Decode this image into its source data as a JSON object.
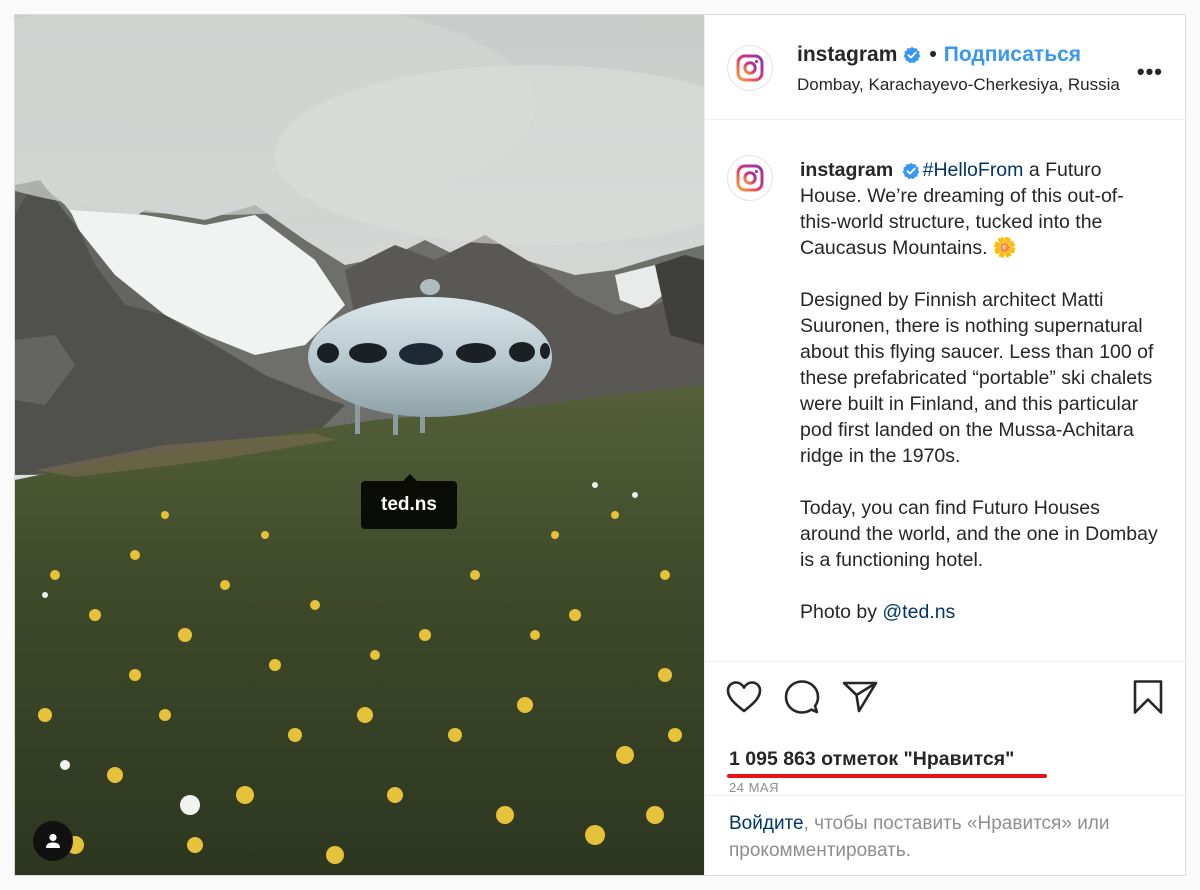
{
  "photo": {
    "tag_label": "ted.ns",
    "user_tag_icon": "user-icon"
  },
  "header": {
    "username": "instagram",
    "separator": "•",
    "follow_label": "Подписаться",
    "location": "Dombay, Karachayevo-Cherkesiya, Russia",
    "more_label": "•••"
  },
  "caption": {
    "username": "instagram",
    "hashtag": "#HelloFrom",
    "para1_rest": " a Futuro House. We’re dreaming of this out-of-this-world structure, tucked into the Caucasus Mountains. 🌼",
    "para2": "Designed by Finnish architect Matti Suuronen, there is nothing supernatural about this flying saucer. Less than 100 of these prefabricated “portable” ski chalets were built in Finland, and this particular pod first landed on the Mussa-Achitara ridge in the 1970s.",
    "para3": "Today, you can find Futuro Houses around the world, and the one in Dombay is a functioning hotel.",
    "photo_by_prefix": "Photo by ",
    "photo_by_handle": "@ted.ns"
  },
  "actions": {
    "like_icon": "heart-icon",
    "comment_icon": "comment-icon",
    "share_icon": "send-icon",
    "save_icon": "bookmark-icon",
    "likes_text": "1 095 863 отметок \"Нравится\"",
    "date": "24 МАЯ"
  },
  "login": {
    "link_label": "Войдите",
    "rest": ", чтобы поставить «Нравится» или прокомментировать."
  },
  "colors": {
    "accent_blue": "#3897f0",
    "link_dark": "#003569",
    "underline_red": "#e8101b"
  }
}
